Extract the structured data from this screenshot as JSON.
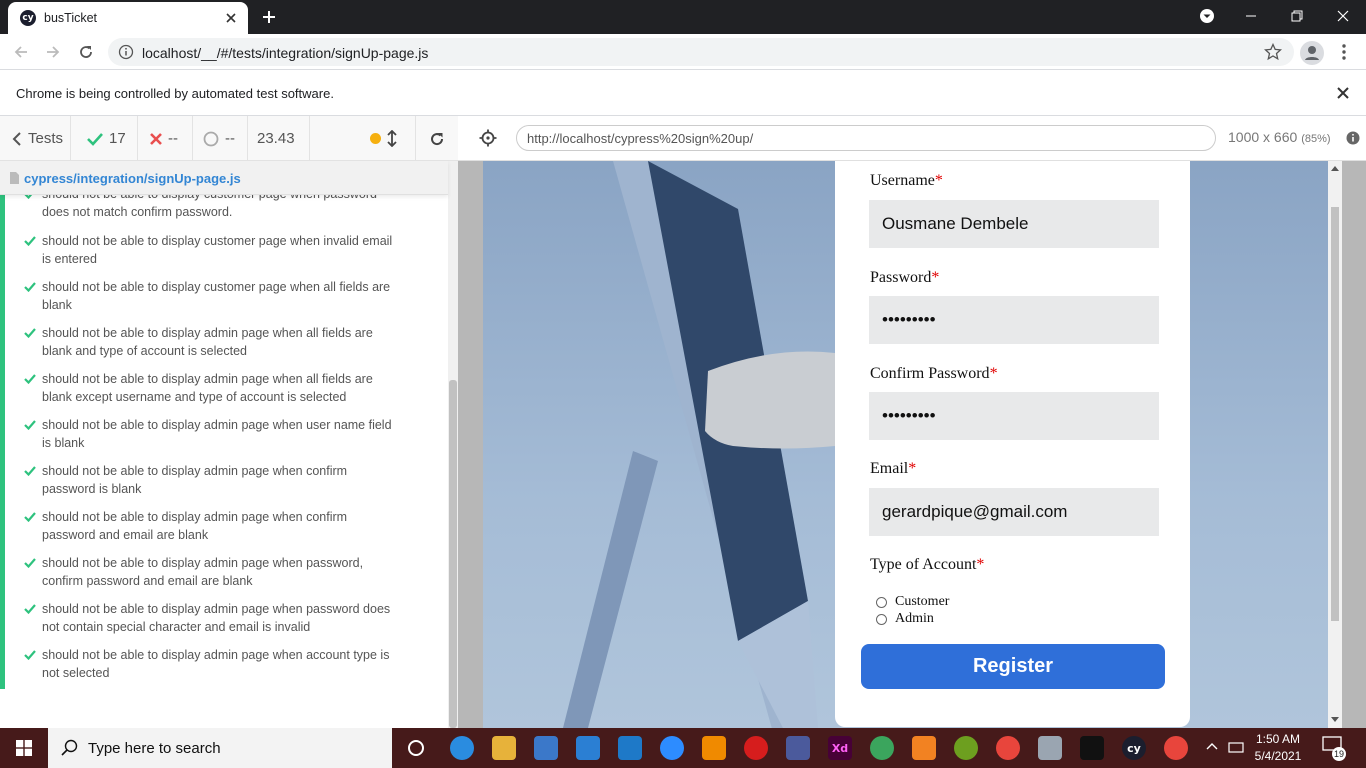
{
  "browser": {
    "tab_title": "busTicket",
    "tab_favicon": "cy",
    "url": "localhost/__/#/tests/integration/signUp-page.js",
    "infobar": "Chrome is being controlled by automated test software."
  },
  "reporter": {
    "tests_label": "Tests",
    "passed": "17",
    "failed": "--",
    "pending": "--",
    "duration": "23.43",
    "spec_file": "cypress/integration/signUp-page.js",
    "tests": [
      "should not be able to display customer page when password does not match confirm password.",
      "should not be able to display customer page when invalid email is entered",
      "should not be able to display customer page when all fields are blank",
      "should not be able to display admin page when all fields are blank and type of account is selected",
      "should not be able to display admin page when all fields are blank except username and type of account is selected",
      "should not be able to display admin page when user name field is blank",
      "should not be able to display admin page when confirm password is blank",
      "should not be able to display admin page when confirm password and email are blank",
      "should not be able to display admin page when password, confirm password and email are blank",
      "should not be able to display admin page when password does not contain special character and email is invalid",
      "should not be able to display admin page when account type is not selected"
    ]
  },
  "aut": {
    "url": "http://localhost/cypress%20sign%20up/",
    "viewport": "1000 x 660",
    "scale": "(85%)"
  },
  "form": {
    "username_label": "Username",
    "username_value": "Ousmane Dembele",
    "password_label": "Password",
    "password_value": "•••••••••",
    "confirm_label": "Confirm Password",
    "confirm_value": "•••••••••",
    "email_label": "Email",
    "email_value": "gerardpique@gmail.com",
    "account_label": "Type of Account",
    "required_mark": "*",
    "option_customer": "Customer",
    "option_admin": "Admin",
    "register_label": "Register"
  },
  "taskbar": {
    "search_placeholder": "Type here to search",
    "time": "1:50 AM",
    "date": "5/4/2021",
    "notifications": "19"
  },
  "colors": {
    "pass_green": "#2ec27e",
    "fail_red": "#e94f4f",
    "register_blue": "#2f6fd9",
    "required_red": "#e00000"
  }
}
